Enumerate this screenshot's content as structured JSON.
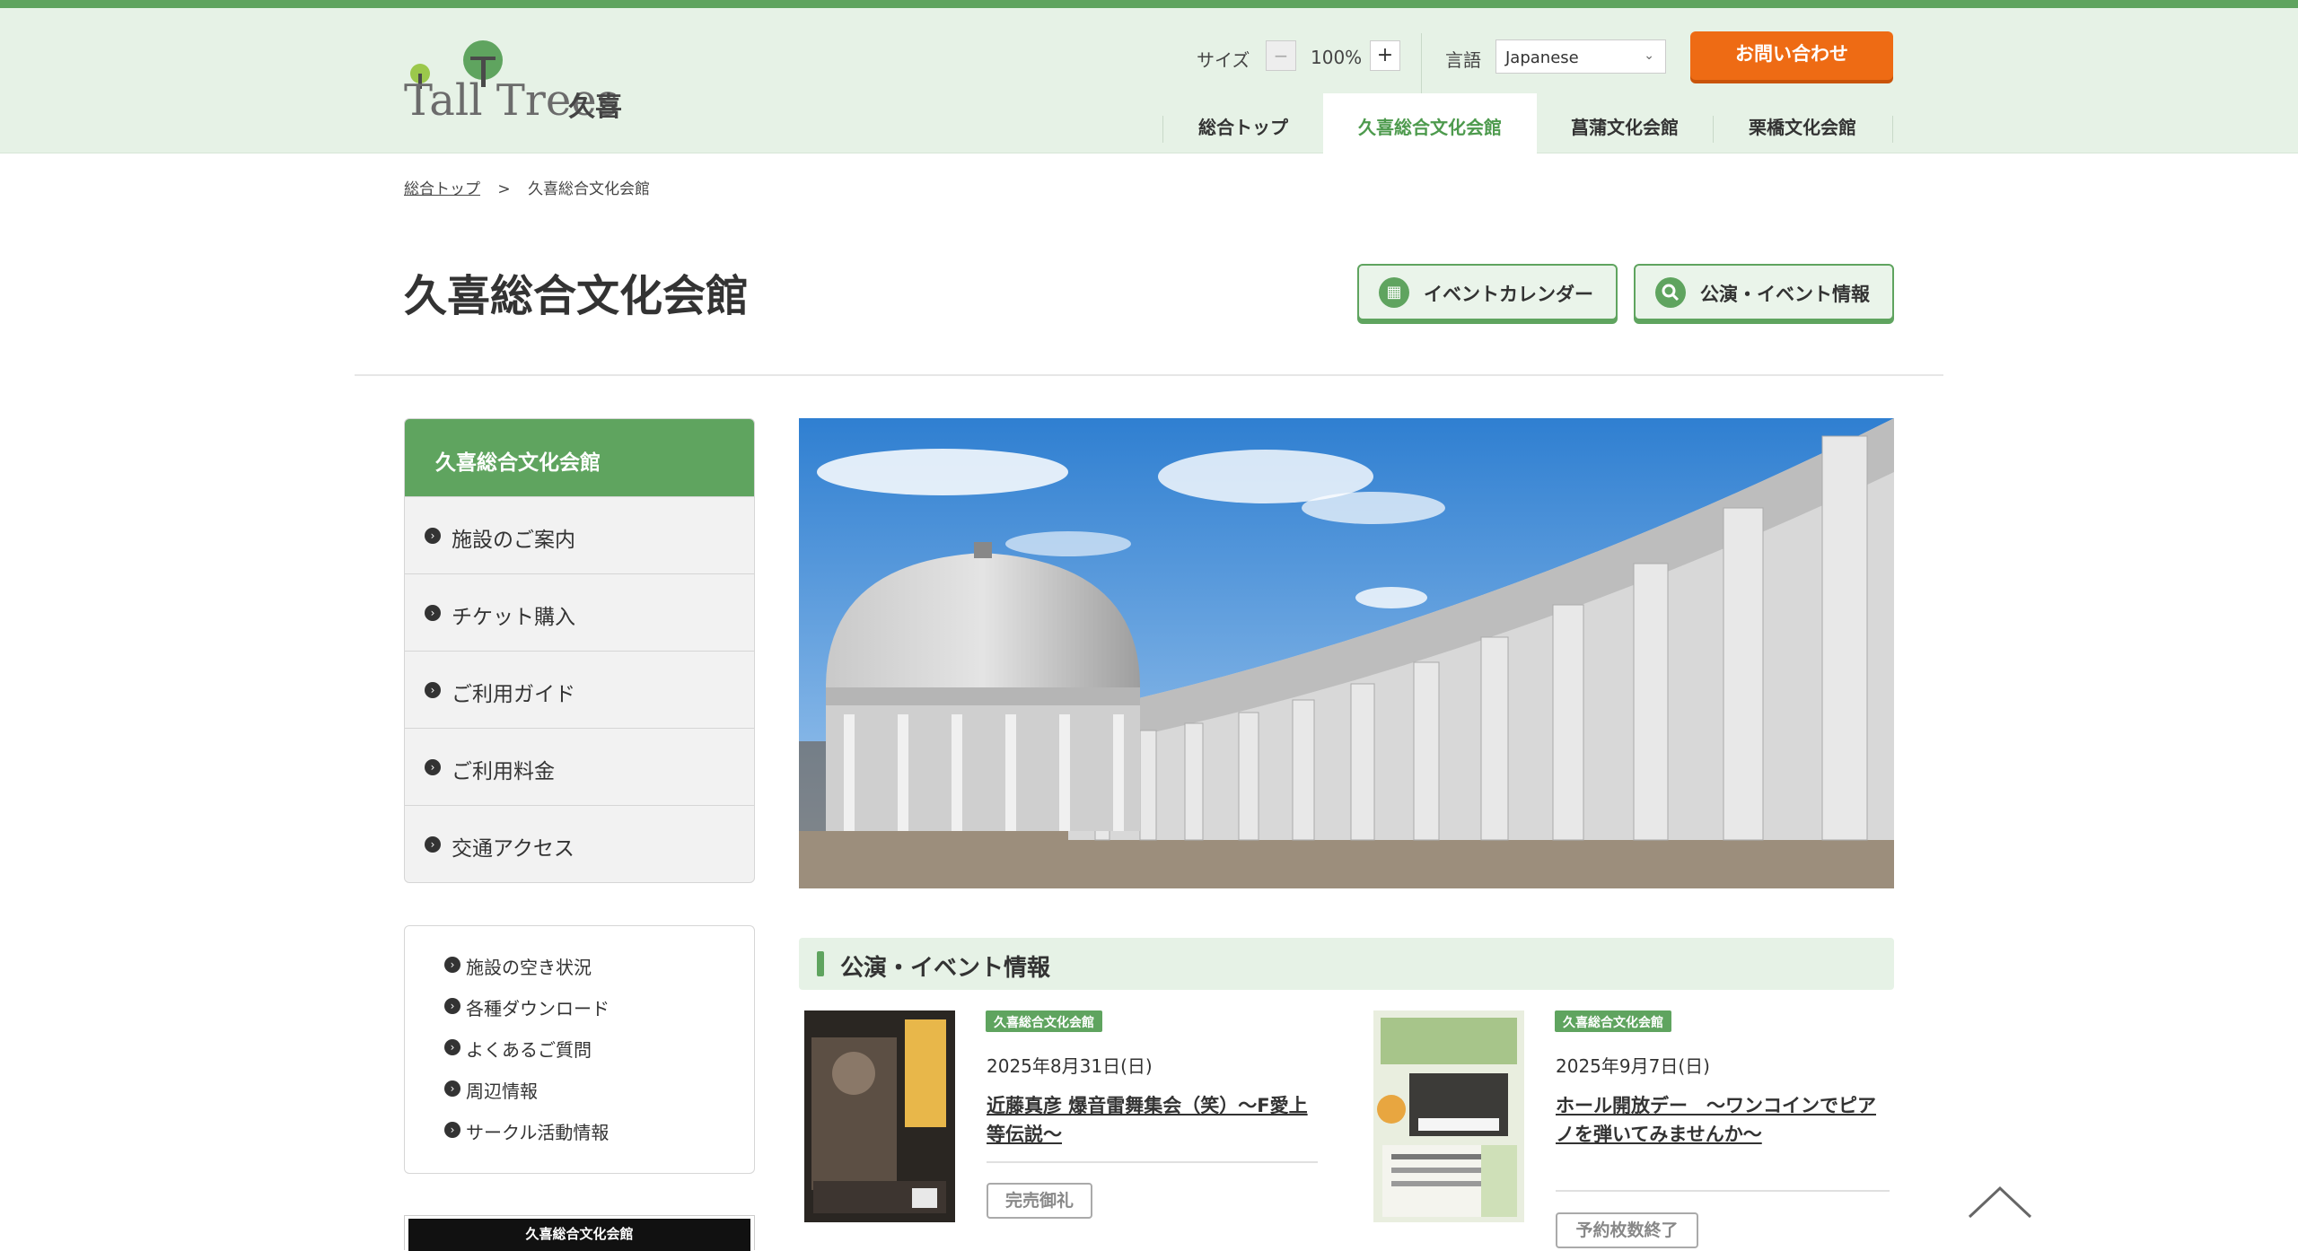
{
  "header": {
    "logo_text": "Tall Trees",
    "logo_kanji": "久喜",
    "size_label": "サイズ",
    "size_minus": "−",
    "size_value": "100%",
    "size_plus": "+",
    "lang_label": "言語",
    "lang_value": "Japanese",
    "contact_label": "お問い合わせ"
  },
  "nav": [
    {
      "label": "総合トップ"
    },
    {
      "label": "久喜総合文化会館"
    },
    {
      "label": "菖蒲文化会館"
    },
    {
      "label": "栗橋文化会館"
    }
  ],
  "breadcrumb": {
    "home": "総合トップ",
    "separator": ">",
    "current": "久喜総合文化会館"
  },
  "page": {
    "title": "久喜総合文化会館",
    "calendar_button": "イベントカレンダー",
    "events_button": "公演・イベント情報"
  },
  "sidebar": {
    "heading": "久喜総合文化会館",
    "items": [
      {
        "label": "施設のご案内"
      },
      {
        "label": "チケット購入"
      },
      {
        "label": "ご利用ガイド"
      },
      {
        "label": "ご利用料金"
      },
      {
        "label": "交通アクセス"
      }
    ]
  },
  "sidebar2": {
    "items": [
      {
        "label": "施設の空き状況"
      },
      {
        "label": "各種ダウンロード"
      },
      {
        "label": "よくあるご質問"
      },
      {
        "label": "周辺情報"
      },
      {
        "label": "サークル活動情報"
      }
    ]
  },
  "banner": {
    "label": "久喜総合文化会館"
  },
  "events_section": {
    "heading": "公演・イベント情報",
    "events": [
      {
        "tag": "久喜総合文化会館",
        "date": "2025年8月31日(日)",
        "title": "近藤真彦 爆音雷舞集会（笑）〜F愛上等伝説〜",
        "status": "完売御礼"
      },
      {
        "tag": "久喜総合文化会館",
        "date": "2025年9月7日(日)",
        "title": "ホール開放デー　〜ワンコインでピアノを弾いてみませんか〜",
        "status": "予約枚数終了"
      }
    ]
  },
  "colors": {
    "accent_green": "#5fa45f",
    "header_bg": "#e6f2e6",
    "contact_orange": "#ee6b14"
  }
}
